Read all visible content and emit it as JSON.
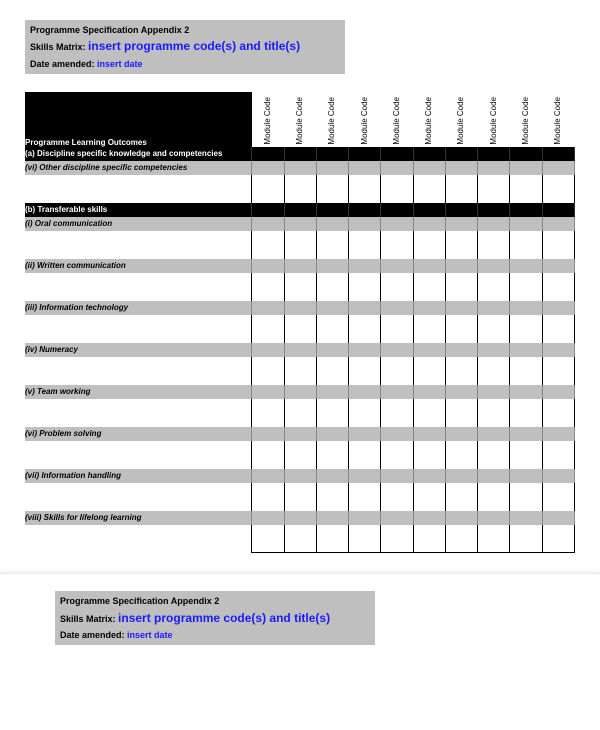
{
  "header": {
    "title": "Programme Specification Appendix 2",
    "skills_label": "Skills Matrix:",
    "skills_value": "insert programme code(s) and title(s)",
    "date_label": "Date amended:",
    "date_value": "insert date"
  },
  "table": {
    "outcomes_header": "Programme Learning Outcomes",
    "module_code_label": "Module Code",
    "num_module_cols": 10,
    "section_a": "(a) Discipline specific knowledge and competencies",
    "row_a_vi": "(vi) Other discipline specific competencies",
    "section_b": "(b) Transferable skills",
    "rows_b": [
      "(i) Oral communication",
      "(ii) Written communication",
      "(iii) Information technology",
      "(iv) Numeracy",
      "(v) Team working",
      "(vi) Problem solving",
      "(vii) Information handling",
      "(viii) Skills for lifelong learning"
    ]
  }
}
